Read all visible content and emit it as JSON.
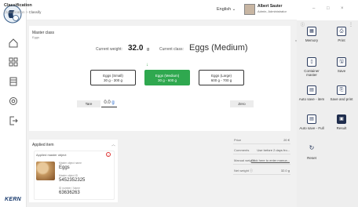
{
  "app": {
    "title": "Classification",
    "breadcrumb": [
      "Classification",
      "Classify"
    ],
    "brand": "KERN"
  },
  "header": {
    "language": "English",
    "user_name": "Albert Sauter",
    "user_role": "Admin, Administrator",
    "win": {
      "minimize": "–",
      "maximize": "□",
      "close": "×"
    }
  },
  "master_class": {
    "label": "Master class",
    "value": "Eggs"
  },
  "current": {
    "weight_label": "Current weight:",
    "weight_value": "32.0",
    "weight_unit": "g",
    "class_label": "Current class:",
    "class_value": "Eggs (Medium)"
  },
  "classes": [
    {
      "name": "Eggs (Small)",
      "range": "30 g - 300 g",
      "active": false
    },
    {
      "name": "Eggs (Medium)",
      "range": "30 g - 600 g",
      "active": true
    },
    {
      "name": "Eggs (Large)",
      "range": "600 g - 700 g",
      "active": false
    }
  ],
  "tare": {
    "label": "Tare",
    "value": "0.0",
    "unit": "g"
  },
  "zero": {
    "label": "Zero"
  },
  "applied": {
    "title": "Applied item",
    "card_title": "Applied master object",
    "fields": [
      {
        "key": "Master object name",
        "value": "Eggs"
      },
      {
        "key": "Master object ID",
        "value": "5452352325"
      },
      {
        "key": "ID number / Name",
        "value": "63636263"
      }
    ]
  },
  "details": [
    {
      "key": "Price",
      "value": "20 €",
      "link": false
    },
    {
      "key": "Comments",
      "value": "Use before 2 days fro...",
      "link": false
    },
    {
      "key": "Manual weight",
      "value": "Click here to enter manua...",
      "link": true
    },
    {
      "key": "Net weight ⓘ",
      "value": "32.0 g",
      "link": false
    }
  ],
  "sidebar": [
    {
      "label": "Memory",
      "icon": "memory-icon",
      "glyph": "▦"
    },
    {
      "label": "Print",
      "icon": "print-icon",
      "glyph": "⎙"
    },
    {
      "label": "Container master",
      "icon": "container-icon",
      "glyph": "▯"
    },
    {
      "label": "Save",
      "icon": "save-icon",
      "glyph": "🖫"
    },
    {
      "label": "Auto save - item",
      "icon": "autosave-item-icon",
      "glyph": "▤"
    },
    {
      "label": "Save and print",
      "icon": "save-print-icon",
      "glyph": "⎘"
    },
    {
      "label": "Auto save - Full",
      "icon": "autosave-full-icon",
      "glyph": "▤"
    },
    {
      "label": "Result",
      "icon": "result-icon",
      "glyph": "▣"
    },
    {
      "label": "Reset",
      "icon": "reset-icon",
      "glyph": "↻"
    }
  ],
  "colors": {
    "accent": "#2fa84f",
    "dark_icon": "#1f2d4d"
  }
}
